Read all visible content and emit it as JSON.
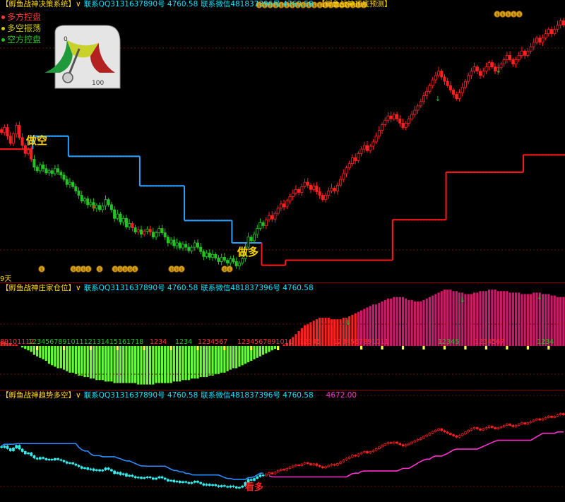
{
  "panel1": {
    "title": "【孵鱼战神决策系统】",
    "contact_qq": "联系QQ3131637890号 4760.58",
    "contact_wx": "联系微信481837396号 4760.58",
    "sub_title": "【孵鱼战神顶底预测】",
    "legend": [
      {
        "label": "多方控盘",
        "color": "#ff3b3b"
      },
      {
        "label": "多空振荡",
        "color": "#d4c800"
      },
      {
        "label": "空方控盘",
        "color": "#22c322"
      }
    ],
    "gauge": {
      "min_label": "0",
      "max_label": "100",
      "value": 62
    },
    "sell_label": "做空",
    "buy_label": "做多",
    "day_label": "9天"
  },
  "panel2": {
    "title": "【孵鱼战神庄家仓位】",
    "contact_qq": "联系QQ3131637890号 4760.58",
    "contact_wx": "联系微信481837396号 4760.58",
    "count_labels": [
      {
        "text": "89101112",
        "color": "#ff3030",
        "col": 0
      },
      {
        "text": "123456789101112131415161718",
        "color": "#22c322",
        "col": 10
      },
      {
        "text": "1234",
        "color": "#ff3030",
        "col": 53
      },
      {
        "text": "1234",
        "color": "#22c322",
        "col": 62
      },
      {
        "text": "1234567",
        "color": "#ff3030",
        "col": 70
      },
      {
        "text": "1234567891011",
        "color": "#ff3030",
        "col": 84
      },
      {
        "text": "12345",
        "color": "#ff3030",
        "col": 106
      },
      {
        "text": "1234567891011",
        "color": "#ff3030",
        "col": 118
      },
      {
        "text": "12345",
        "color": "#22c322",
        "col": 155
      },
      {
        "text": "1234567",
        "color": "#ff3030",
        "col": 168
      },
      {
        "text": "1234",
        "color": "#22c322",
        "col": 190
      }
    ]
  },
  "panel3": {
    "title": "【孵鱼战神趋势多空】",
    "contact_qq": "联系QQ3131637890号 4760.58",
    "contact_wx": "联系微信481837396号 4760.58",
    "value_label": "4672.00",
    "buy_label": "看多"
  },
  "chart_data": [
    {
      "type": "candlestick",
      "name": "main",
      "close": [
        4705,
        4712,
        4700,
        4690,
        4703,
        4715,
        4698,
        4687,
        4676,
        4681,
        4668,
        4657,
        4652,
        4660,
        4655,
        4649,
        4652,
        4648,
        4655,
        4650,
        4646,
        4640,
        4633,
        4636,
        4630,
        4624,
        4618,
        4610,
        4613,
        4605,
        4608,
        4600,
        4604,
        4598,
        4603,
        4612,
        4605,
        4598,
        4586,
        4592,
        4581,
        4586,
        4574,
        4579,
        4573,
        4567,
        4570,
        4564,
        4568,
        4571,
        4567,
        4560,
        4566,
        4572,
        4566,
        4560,
        4552,
        4556,
        4548,
        4552,
        4545,
        4550,
        4546,
        4541,
        4546,
        4552,
        4546,
        4540,
        4533,
        4538,
        4532,
        4536,
        4531,
        4526,
        4532,
        4528,
        4524,
        4530,
        4526,
        4520,
        4524,
        4530,
        4546,
        4560,
        4555,
        4564,
        4572,
        4580,
        4576,
        4584,
        4590,
        4585,
        4593,
        4600,
        4606,
        4602,
        4610,
        4616,
        4621,
        4626,
        4622,
        4630,
        4636,
        4632,
        4626,
        4631,
        4623,
        4618,
        4612,
        4618,
        4624,
        4628,
        4624,
        4632,
        4640,
        4648,
        4656,
        4662,
        4670,
        4666,
        4676,
        4682,
        4687,
        4680,
        4686,
        4692,
        4700,
        4708,
        4716,
        4722,
        4728,
        4724,
        4730,
        4724,
        4718,
        4712,
        4718,
        4724,
        4730,
        4736,
        4742,
        4748,
        4756,
        4762,
        4770,
        4778,
        4784,
        4790,
        4782,
        4776,
        4770,
        4764,
        4758,
        4752,
        4760,
        4768,
        4776,
        4784,
        4790,
        4796,
        4790,
        4784,
        4790,
        4796,
        4802,
        4796,
        4790,
        4795,
        4800,
        4806,
        4812,
        4806,
        4800,
        4806,
        4812,
        4818,
        4812,
        4818,
        4824,
        4830,
        4836,
        4830,
        4836,
        4842,
        4848,
        4842,
        4848,
        4854,
        4860,
        4854
      ],
      "ylim": [
        4505,
        4830
      ]
    },
    {
      "type": "step-line",
      "name": "stop-line",
      "values": [
        [
          0,
          11,
          4682,
          "red"
        ],
        [
          11,
          23,
          4700,
          "blue"
        ],
        [
          23,
          47,
          4672,
          "blue"
        ],
        [
          47,
          62,
          4631,
          "blue"
        ],
        [
          62,
          78,
          4583,
          "blue"
        ],
        [
          78,
          88,
          4552,
          "blue"
        ],
        [
          88,
          96,
          4521,
          "red"
        ],
        [
          96,
          132,
          4528,
          "red"
        ],
        [
          132,
          150,
          4584,
          "red"
        ],
        [
          150,
          176,
          4650,
          "red"
        ],
        [
          176,
          192,
          4674,
          "red"
        ],
        [
          192,
          200,
          4733,
          "red"
        ]
      ]
    },
    {
      "type": "bar",
      "name": "position",
      "values": [
        3,
        3,
        2,
        2,
        1,
        1,
        0,
        -1,
        -2,
        -3,
        -4,
        -6,
        -7,
        -8,
        -9,
        -10,
        -12,
        -13,
        -14,
        -15,
        -15,
        -16,
        -17,
        -18,
        -18,
        -19,
        -20,
        -20,
        -21,
        -21,
        -22,
        -22,
        -23,
        -23,
        -23,
        -24,
        -24,
        -24,
        -25,
        -25,
        -25,
        -25,
        -25,
        -25,
        -25,
        -25,
        -26,
        -26,
        -26,
        -26,
        -26,
        -26,
        -25,
        -25,
        -25,
        -25,
        -25,
        -25,
        -24,
        -24,
        -24,
        -23,
        -23,
        -23,
        -22,
        -22,
        -22,
        -21,
        -21,
        -21,
        -20,
        -20,
        -19,
        -19,
        -18,
        -18,
        -17,
        -16,
        -15,
        -15,
        -14,
        -13,
        -12,
        -11,
        -10,
        -9,
        -8,
        -7,
        -6,
        -5,
        -4,
        -3,
        -2,
        -1,
        0,
        1,
        2,
        4,
        6,
        8,
        10,
        12,
        14,
        15,
        16,
        17,
        18,
        19,
        19,
        19,
        19,
        18,
        18,
        18,
        18,
        19,
        19,
        20,
        21,
        22,
        23,
        24,
        25,
        26,
        27,
        28,
        28,
        29,
        30,
        31,
        32,
        32,
        33,
        33,
        33,
        33,
        32,
        31,
        31,
        30,
        30,
        30,
        31,
        32,
        33,
        34,
        35,
        36,
        37,
        38,
        38,
        38,
        37,
        37,
        36,
        36,
        35,
        35,
        35,
        36,
        36,
        37,
        37,
        37,
        38,
        38,
        38,
        37,
        37,
        37,
        37,
        36,
        36,
        36,
        36,
        35,
        35,
        35,
        35,
        36,
        36,
        36,
        35,
        35,
        35,
        34,
        34,
        33,
        33,
        33,
        32,
        32,
        31,
        31,
        31,
        30,
        30
      ],
      "ylim": [
        -30,
        40
      ]
    },
    {
      "type": "line",
      "name": "trend",
      "ylim": [
        4505,
        4830
      ]
    }
  ]
}
